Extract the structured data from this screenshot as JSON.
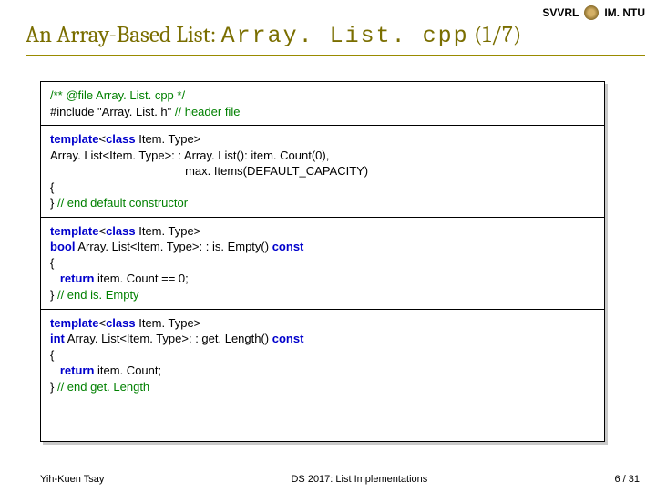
{
  "header": {
    "left": "SVVRL",
    "right": "IM. NTU"
  },
  "title": {
    "prefix": "An Array-Based List: ",
    "mono": "Array. List. cpp",
    "suffix": " (1/7)"
  },
  "code": {
    "s1_l1": "/** @file Array. List. cpp */",
    "s1_l2a": "#include \"Array. List. h\"  ",
    "s1_l2b": "// header file",
    "s2_l1a": "template",
    "s2_l1b": "<",
    "s2_l1c": "class",
    "s2_l1d": " Item. Type>",
    "s2_l2": "Array. List<Item. Type>: : Array. List(): item. Count(0),",
    "s2_l3": "                                         max. Items(DEFAULT_CAPACITY)",
    "s2_l4": "{",
    "s2_l5a": "} ",
    "s2_l5b": "// end default constructor",
    "s3_l1a": "template",
    "s3_l1b": "<",
    "s3_l1c": "class",
    "s3_l1d": " Item. Type>",
    "s3_l2a": "bool",
    "s3_l2b": " Array. List<Item. Type>: : is. Empty() ",
    "s3_l2c": "const",
    "s3_l3": "{",
    "s3_l4a": "   ",
    "s3_l4b": "return",
    "s3_l4c": " item. Count == 0;",
    "s3_l5a": "}  ",
    "s3_l5b": "// end is. Empty",
    "s4_l1a": "template",
    "s4_l1b": "<",
    "s4_l1c": "class",
    "s4_l1d": " Item. Type>",
    "s4_l2a": "int",
    "s4_l2b": " Array. List<Item. Type>: : get. Length() ",
    "s4_l2c": "const",
    "s4_l3": "{",
    "s4_l4a": "   ",
    "s4_l4b": "return",
    "s4_l4c": " item. Count;",
    "s4_l5a": "} ",
    "s4_l5b": "// end get. Length"
  },
  "footer": {
    "left": "Yih-Kuen Tsay",
    "center": "DS 2017: List Implementations",
    "right": "6 / 31"
  }
}
